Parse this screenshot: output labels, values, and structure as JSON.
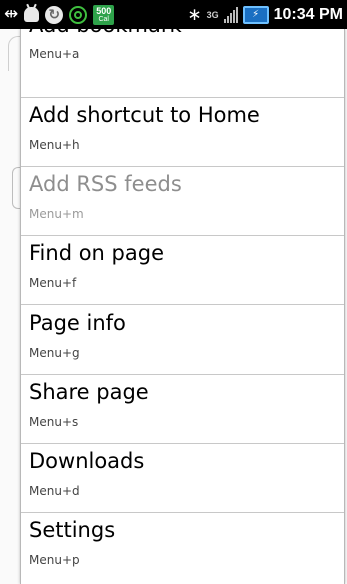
{
  "status_bar": {
    "calendar_number": "500",
    "calendar_label": "Cal",
    "network": "3G",
    "time": "10:34 PM",
    "icons": [
      "usb-icon",
      "android-debug-icon",
      "sync-icon",
      "wifi-icon",
      "calendar-icon",
      "bluetooth-icon",
      "network-3g-icon",
      "signal-icon",
      "battery-charging-icon"
    ]
  },
  "menu": {
    "items": [
      {
        "label": "Add bookmark",
        "shortcut": "Menu+a",
        "enabled": true
      },
      {
        "label": "Add shortcut to Home",
        "shortcut": "Menu+h",
        "enabled": true
      },
      {
        "label": "Add RSS feeds",
        "shortcut": "Menu+m",
        "enabled": false
      },
      {
        "label": "Find on page",
        "shortcut": "Menu+f",
        "enabled": true
      },
      {
        "label": "Page info",
        "shortcut": "Menu+g",
        "enabled": true
      },
      {
        "label": "Share page",
        "shortcut": "Menu+s",
        "enabled": true
      },
      {
        "label": "Downloads",
        "shortcut": "Menu+d",
        "enabled": true
      },
      {
        "label": "Settings",
        "shortcut": "Menu+p",
        "enabled": true
      }
    ]
  },
  "colors": {
    "status_bar_bg": "#000000",
    "menu_bg": "#ffffff",
    "divider": "#c8c8c8",
    "disabled_text": "#8e8e8e",
    "calendar_green": "#2ea24a"
  }
}
